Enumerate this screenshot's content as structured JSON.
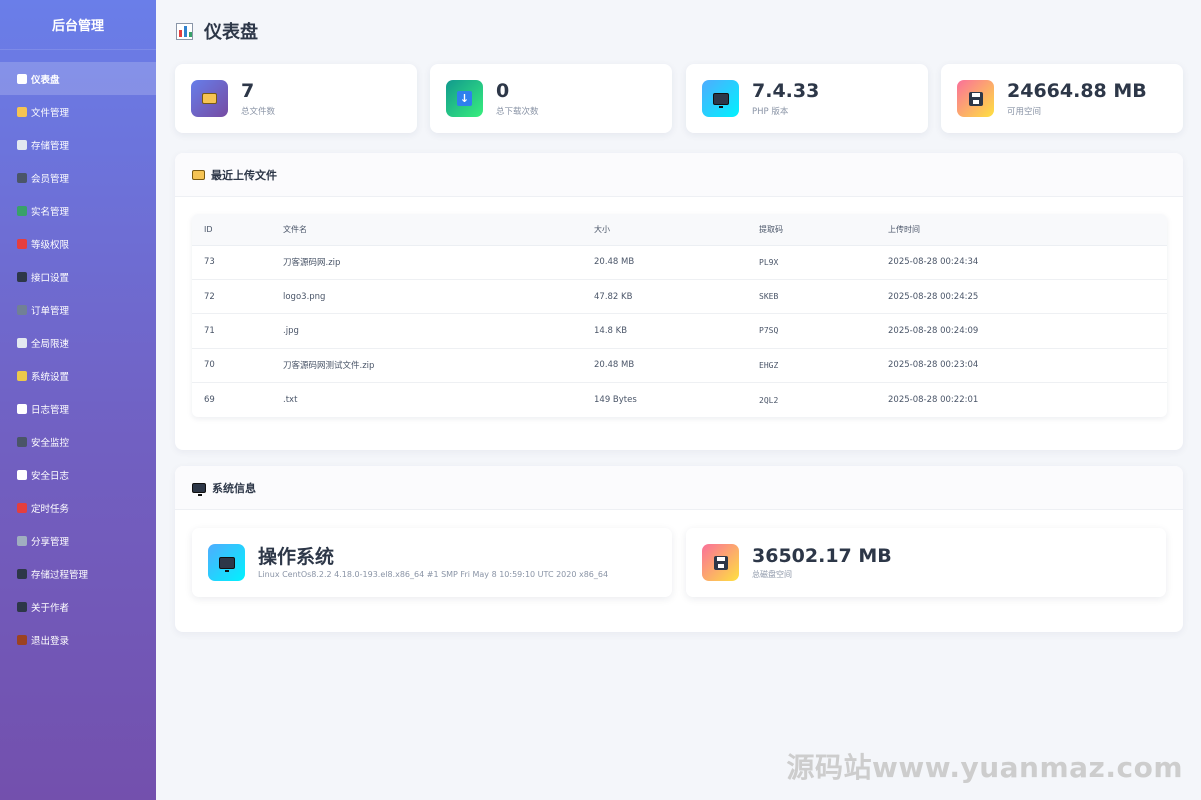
{
  "sidebar": {
    "brand": "后台管理",
    "items": [
      {
        "label": "仪表盘",
        "active": true,
        "icon": "chart-icon",
        "color": "#ffffff"
      },
      {
        "label": "文件管理",
        "icon": "folder-icon",
        "color": "#f6c453"
      },
      {
        "label": "存储管理",
        "icon": "storage-icon",
        "color": "#e2e8f0"
      },
      {
        "label": "会员管理",
        "icon": "users-icon",
        "color": "#4a5568"
      },
      {
        "label": "实名管理",
        "icon": "check-icon",
        "color": "#38a169"
      },
      {
        "label": "等级权限",
        "icon": "shield-icon",
        "color": "#e53e3e"
      },
      {
        "label": "接口设置",
        "icon": "plug-icon",
        "color": "#2d3748"
      },
      {
        "label": "订单管理",
        "icon": "cart-icon",
        "color": "#718096"
      },
      {
        "label": "全局限速",
        "icon": "rocket-icon",
        "color": "#e2e8f0"
      },
      {
        "label": "系统设置",
        "icon": "pencil-icon",
        "color": "#ecc94b"
      },
      {
        "label": "日志管理",
        "icon": "document-icon",
        "color": "#ffffff"
      },
      {
        "label": "安全监控",
        "icon": "eye-icon",
        "color": "#4a5568"
      },
      {
        "label": "安全日志",
        "icon": "document-icon",
        "color": "#ffffff"
      },
      {
        "label": "定时任务",
        "icon": "alarm-icon",
        "color": "#e53e3e"
      },
      {
        "label": "分享管理",
        "icon": "link-icon",
        "color": "#a0aec0"
      },
      {
        "label": "存储过程管理",
        "icon": "laptop-icon",
        "color": "#2d3748"
      },
      {
        "label": "关于作者",
        "icon": "person-icon",
        "color": "#2d3748"
      },
      {
        "label": "退出登录",
        "icon": "door-icon",
        "color": "#9c4221"
      }
    ]
  },
  "page": {
    "title": "仪表盘"
  },
  "stats": [
    {
      "value": "7",
      "label": "总文件数",
      "icon": "folder-icon",
      "gradient": [
        "#667eea",
        "#764ba2"
      ]
    },
    {
      "value": "0",
      "label": "总下载次数",
      "icon": "download-icon",
      "gradient": [
        "#11998e",
        "#38ef7d"
      ]
    },
    {
      "value": "7.4.33",
      "label": "PHP 版本",
      "icon": "monitor-icon",
      "gradient": [
        "#4facfe",
        "#00f2fe"
      ]
    },
    {
      "value": "24664.88 MB",
      "label": "可用空间",
      "icon": "disk-icon",
      "gradient": [
        "#fa709a",
        "#fee140"
      ]
    }
  ],
  "recent": {
    "title": "最近上传文件",
    "columns": [
      "ID",
      "文件名",
      "大小",
      "提取码",
      "上传时间"
    ],
    "rows": [
      [
        "73",
        "刀客源码网.zip",
        "20.48 MB",
        "PL9X",
        "2025-08-28 00:24:34"
      ],
      [
        "72",
        "logo3.png",
        "47.82 KB",
        "SKEB",
        "2025-08-28 00:24:25"
      ],
      [
        "71",
        ".jpg",
        "14.8 KB",
        "P7SQ",
        "2025-08-28 00:24:09"
      ],
      [
        "70",
        "刀客源码网测试文件.zip",
        "20.48 MB",
        "EHGZ",
        "2025-08-28 00:23:04"
      ],
      [
        "69",
        ".txt",
        "149 Bytes",
        "2QL2",
        "2025-08-28 00:22:01"
      ]
    ]
  },
  "system": {
    "title": "系统信息",
    "os": {
      "value": "操作系统",
      "sub": "Linux CentOs8.2.2 4.18.0-193.el8.x86_64 #1 SMP Fri May 8 10:59:10 UTC 2020 x86_64"
    },
    "disk": {
      "value": "36502.17 MB",
      "sub": "总磁盘空间"
    }
  },
  "watermark": "源码站www.yuanmaz.com"
}
